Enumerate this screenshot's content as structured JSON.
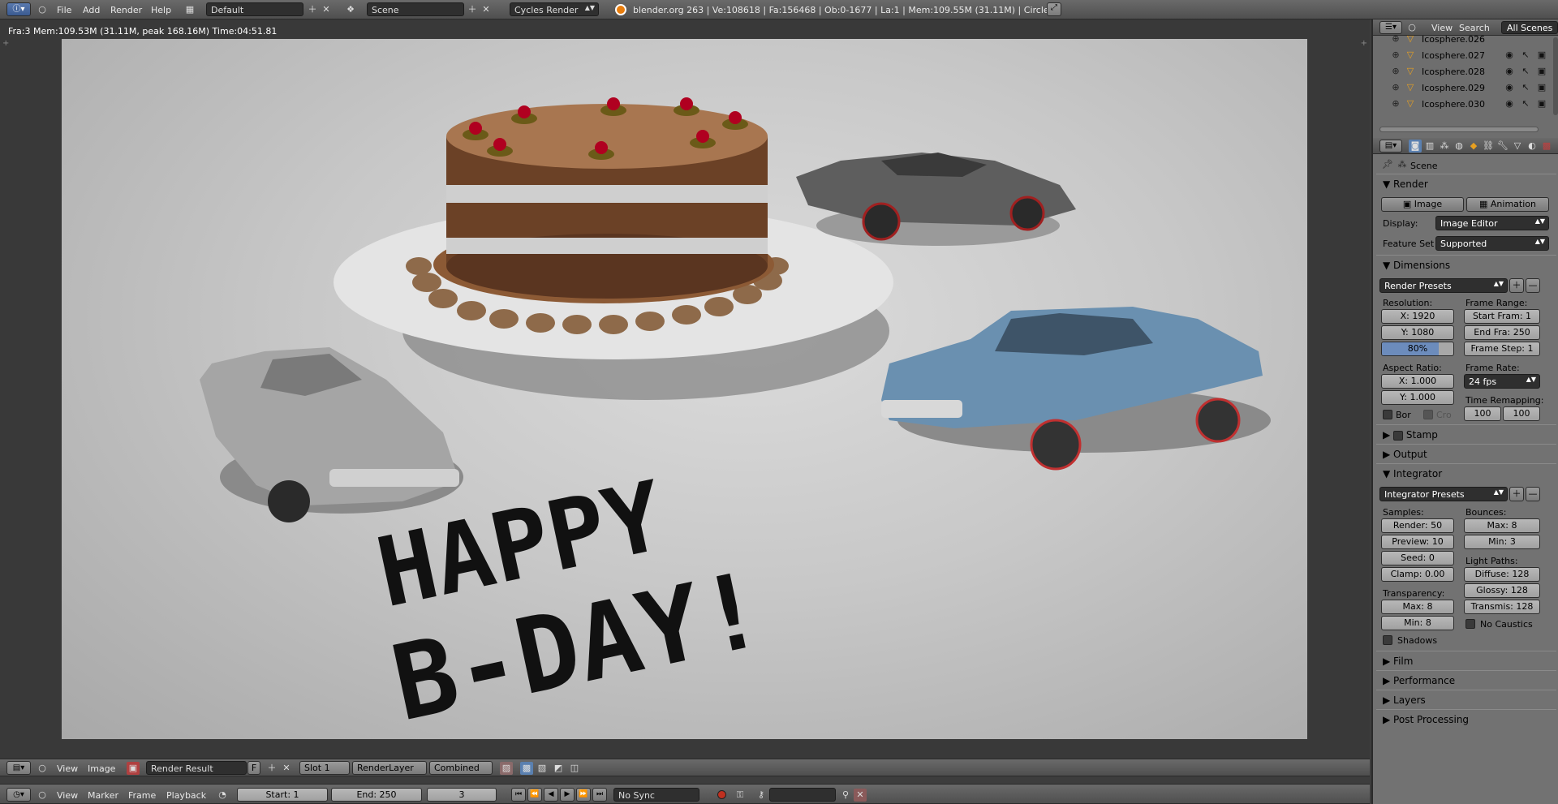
{
  "topbar": {
    "menus": [
      "File",
      "Add",
      "Render",
      "Help"
    ],
    "layout": "Default",
    "scene": "Scene",
    "engine": "Cycles Render",
    "stats": "blender.org 263 | Ve:108618 | Fa:156468 | Ob:0-1677 | La:1 | Mem:109.55M (31.11M) | Circle"
  },
  "viewer": {
    "info": "Fra:3  Mem:109.53M (31.11M, peak 168.16M) Time:04:51.81",
    "render_text": [
      "HAPPY",
      "B-DAY!"
    ]
  },
  "image_header": {
    "menus": [
      "View",
      "Image"
    ],
    "image_name": "Render Result",
    "fake_user": "F",
    "slot": "Slot 1",
    "layer": "RenderLayer",
    "pass": "Combined"
  },
  "timeline": {
    "menus": [
      "View",
      "Marker",
      "Frame",
      "Playback"
    ],
    "start": "Start: 1",
    "end": "End: 250",
    "current": "3",
    "sync": "No Sync"
  },
  "outliner": {
    "menus": [
      "View",
      "Search"
    ],
    "filter": "All Scenes",
    "items": [
      "Icosphere.026",
      "Icosphere.027",
      "Icosphere.028",
      "Icosphere.029",
      "Icosphere.030"
    ]
  },
  "properties": {
    "context": "Scene",
    "render": {
      "title": "Render",
      "image_btn": "Image",
      "animation_btn": "Animation",
      "display_label": "Display:",
      "display_value": "Image Editor",
      "feature_label": "Feature Set",
      "feature_value": "Supported"
    },
    "dimensions": {
      "title": "Dimensions",
      "presets": "Render Presets",
      "resolution_label": "Resolution:",
      "res_x": "X: 1920",
      "res_y": "Y: 1080",
      "res_pct": "80%",
      "res_pct_value": 0.8,
      "aspect_label": "Aspect Ratio:",
      "asp_x": "X: 1.000",
      "asp_y": "Y: 1.000",
      "border": "Bor",
      "crop": "Cro",
      "frame_range_label": "Frame Range:",
      "start": "Start Fram: 1",
      "end": "End Fra: 250",
      "step": "Frame Step: 1",
      "frame_rate_label": "Frame Rate:",
      "fps": "24 fps",
      "time_remap_label": "Time Remapping:",
      "remap_old": "100",
      "remap_new": "100"
    },
    "collapsed1": [
      "Stamp",
      "Output"
    ],
    "integrator": {
      "title": "Integrator",
      "presets": "Integrator Presets",
      "samples_label": "Samples:",
      "render": "Render: 50",
      "preview": "Preview: 10",
      "seed": "Seed: 0",
      "clamp": "Clamp: 0.00",
      "transparency_label": "Transparency:",
      "t_max": "Max: 8",
      "t_min": "Min: 8",
      "shadows": "Shadows",
      "bounces_label": "Bounces:",
      "b_max": "Max: 8",
      "b_min": "Min: 3",
      "light_paths_label": "Light Paths:",
      "diffuse": "Diffuse: 128",
      "glossy": "Glossy: 128",
      "transmis": "Transmis: 128",
      "no_caustics": "No Caustics"
    },
    "collapsed2": [
      "Film",
      "Performance",
      "Layers",
      "Post Processing"
    ]
  }
}
